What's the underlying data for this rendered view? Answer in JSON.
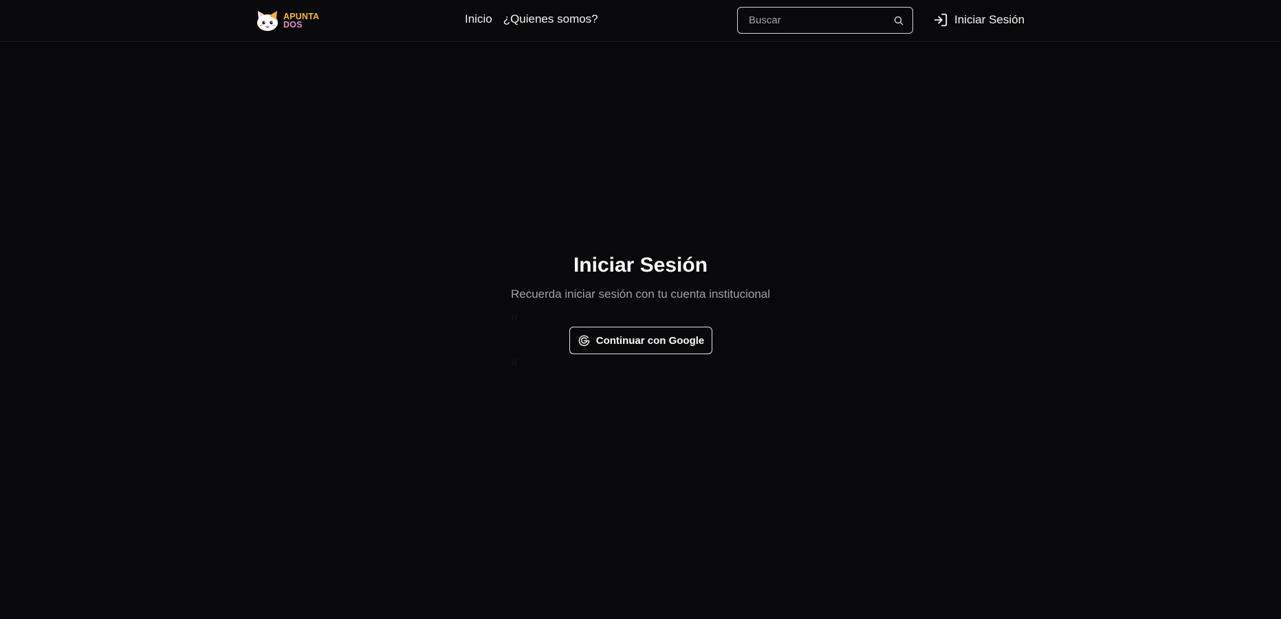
{
  "brand": {
    "line1": "APUNTA",
    "line2": "DOS"
  },
  "nav": {
    "links": [
      {
        "label": "Inicio"
      },
      {
        "label": "¿Quienes somos?"
      }
    ],
    "search_placeholder": "Buscar",
    "login_label": "Iniciar Sesión"
  },
  "login": {
    "title": "Iniciar Sesión",
    "subtitle": "Recuerda iniciar sesión con tu cuenta institucional",
    "google_button_label": "Continuar con Google",
    "comment_marks": [
      "//",
      "//"
    ]
  },
  "icons": {
    "logo": "cat-logo-icon",
    "search": "search-icon",
    "login": "log-in-icon",
    "google": "google-icon"
  },
  "colors": {
    "background": "#09090b",
    "brand_yellow": "#f6b82e",
    "brand_pink": "#e58cc4",
    "text_muted": "#a1a1aa",
    "border": "#e4e4e7"
  }
}
